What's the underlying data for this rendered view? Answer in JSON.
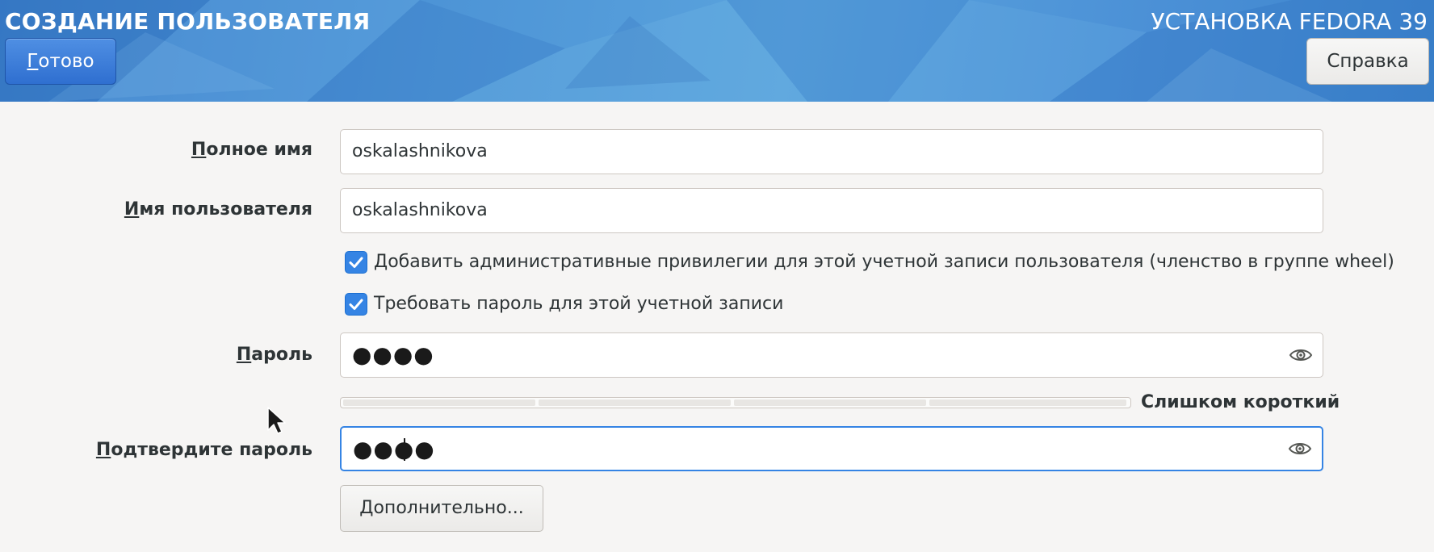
{
  "header": {
    "page_title": "СОЗДАНИЕ ПОЛЬЗОВАТЕЛЯ",
    "install_title": "УСТАНОВКА FEDORA 39",
    "done_label": "Готово",
    "help_label": "Справка"
  },
  "form": {
    "full_name_label": "Полное имя",
    "full_name_value": "oskalashnikova",
    "username_label": "Имя пользователя",
    "username_value": "oskalashnikova",
    "admin_checkbox_label": "Добавить административные привилегии для этой учетной записи пользователя (членство в группе wheel)",
    "admin_checked": true,
    "require_password_label": "Требовать пароль для этой учетной записи",
    "require_password_checked": true,
    "password_label": "Пароль",
    "password_value": "●●●●",
    "strength_text": "Слишком короткий",
    "strength_level": 0,
    "confirm_label": "Подтвердите пароль",
    "confirm_value": "●●●●",
    "advanced_label": "Дополнительно..."
  },
  "icons": {
    "reveal": "eye-icon",
    "check": "checkmark-icon",
    "pointer": "mouse-pointer-icon"
  },
  "colors": {
    "accent": "#3584e4",
    "header_blue": "#4d94d6",
    "background": "#f6f5f4"
  }
}
